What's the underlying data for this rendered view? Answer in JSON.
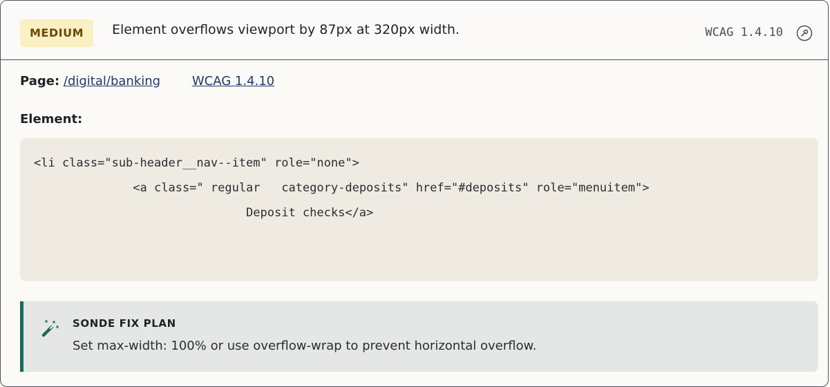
{
  "issue": {
    "severity": "MEDIUM",
    "headline": "Element overflows viewport by 87px at 320px width.",
    "wcag_tag": "WCAG 1.4.10"
  },
  "meta": {
    "page_label": "Page:",
    "page_link": "/digital/banking",
    "wcag_link": "WCAG 1.4.10"
  },
  "element": {
    "label": "Element:",
    "code": "<li class=\"sub-header__nav--item\" role=\"none\">\n              <a class=\" regular   category-deposits\" href=\"#deposits\" role=\"menuitem\">\n                              Deposit checks</a>"
  },
  "fix_plan": {
    "title": "SONDE FIX PLAN",
    "text": "Set max-width: 100% or use overflow-wrap to prevent horizontal overflow."
  },
  "colors": {
    "severity_bg": "#fbefc4",
    "severity_text": "#6b4a08",
    "link": "#1f3a68",
    "code_bg": "#efebe2",
    "fix_bg": "#e5e7e6",
    "fix_accent": "#1e6b5c"
  },
  "icons": {
    "header_action": "pin-icon",
    "fix": "magic-wand-icon"
  }
}
